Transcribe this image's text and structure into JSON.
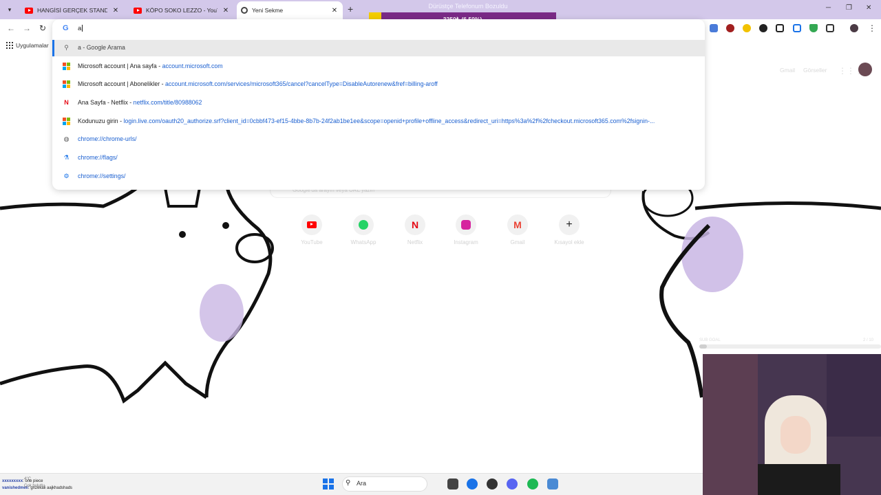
{
  "browser": {
    "tabs": [
      {
        "title": "HANGİSİ GERÇEK STAND-UP K",
        "favicon": "youtube-icon",
        "active": false
      },
      {
        "title": "KÖPO SOKO LEZZO - YouTube",
        "favicon": "youtube-icon",
        "active": false
      },
      {
        "title": "Yeni Sekme",
        "favicon": "chrome-icon",
        "active": true
      }
    ],
    "bookmark_bar": {
      "apps_label": "Uygulamalar"
    }
  },
  "stream_overlay": {
    "title": "Dürüstçe Telefonum Bozuldu",
    "progress_text": "3250₺ (6.50%)",
    "progress_percent": 6.5,
    "progress_color": "#f3cd00",
    "bar_color": "#7a2a86",
    "goal_left": "SUB GOAL",
    "goal_right": "2 / 10",
    "goal_fraction": 0.04
  },
  "omnibox": {
    "typed_text": "a",
    "suggestions": [
      {
        "icon": "search-icon",
        "text": "a - Google Arama",
        "url": ""
      },
      {
        "icon": "microsoft-icon",
        "text": "Microsoft account | Ana sayfa - ",
        "url": "account.microsoft.com"
      },
      {
        "icon": "microsoft-icon",
        "text": "Microsoft account | Abonelikler - ",
        "url": "account.microsoft.com/services/microsoft365/cancel?cancelType=DisableAutorenew&fref=billing-aroff"
      },
      {
        "icon": "netflix-icon",
        "text": "Ana Sayfa - Netflix - ",
        "url": "netflix.com/title/80988062"
      },
      {
        "icon": "microsoft-icon",
        "text": "Kodunuzu girin - ",
        "url": "login.live.com/oauth20_authorize.srf?client_id=0cbbf473-ef15-4bbe-8b7b-24f2ab1be1ee&scope=openid+profile+offline_access&redirect_uri=https%3a%2f%2fcheckout.microsoft365.com%2fsignin-..."
      },
      {
        "icon": "globe-icon",
        "text": "",
        "url": "chrome://chrome-urls/"
      },
      {
        "icon": "flask-icon",
        "text": "",
        "url": "chrome://flags/"
      },
      {
        "icon": "settings-icon",
        "text": "",
        "url": "chrome://settings/"
      }
    ]
  },
  "newtab": {
    "header_links": [
      "Gmail",
      "Görseller"
    ],
    "search_placeholder": "Google'da arayın veya URL yazın",
    "shortcuts": [
      {
        "label": "YouTube",
        "icon": "youtube-icon",
        "color": "#ff0000"
      },
      {
        "label": "WhatsApp",
        "icon": "whatsapp-icon",
        "color": "#25d366"
      },
      {
        "label": "Netflix",
        "icon": "netflix-icon",
        "color": "#e50914"
      },
      {
        "label": "Instagram",
        "icon": "instagram-icon",
        "color": "#d6249f"
      },
      {
        "label": "Gmail",
        "icon": "gmail-icon",
        "color": "#ea4335"
      },
      {
        "label": "Kısayol ekle",
        "icon": "plus-icon",
        "color": "#333333"
      }
    ]
  },
  "taskbar": {
    "search_label": "Ara",
    "weather": "4°C",
    "weather_desc": "Çok bulutlu"
  },
  "chat": [
    {
      "user": "xxxxxxxxx",
      "message": ": one piece"
    },
    {
      "user": "vanishedmeli",
      "message": ": grizekali aajkhadshads"
    }
  ]
}
